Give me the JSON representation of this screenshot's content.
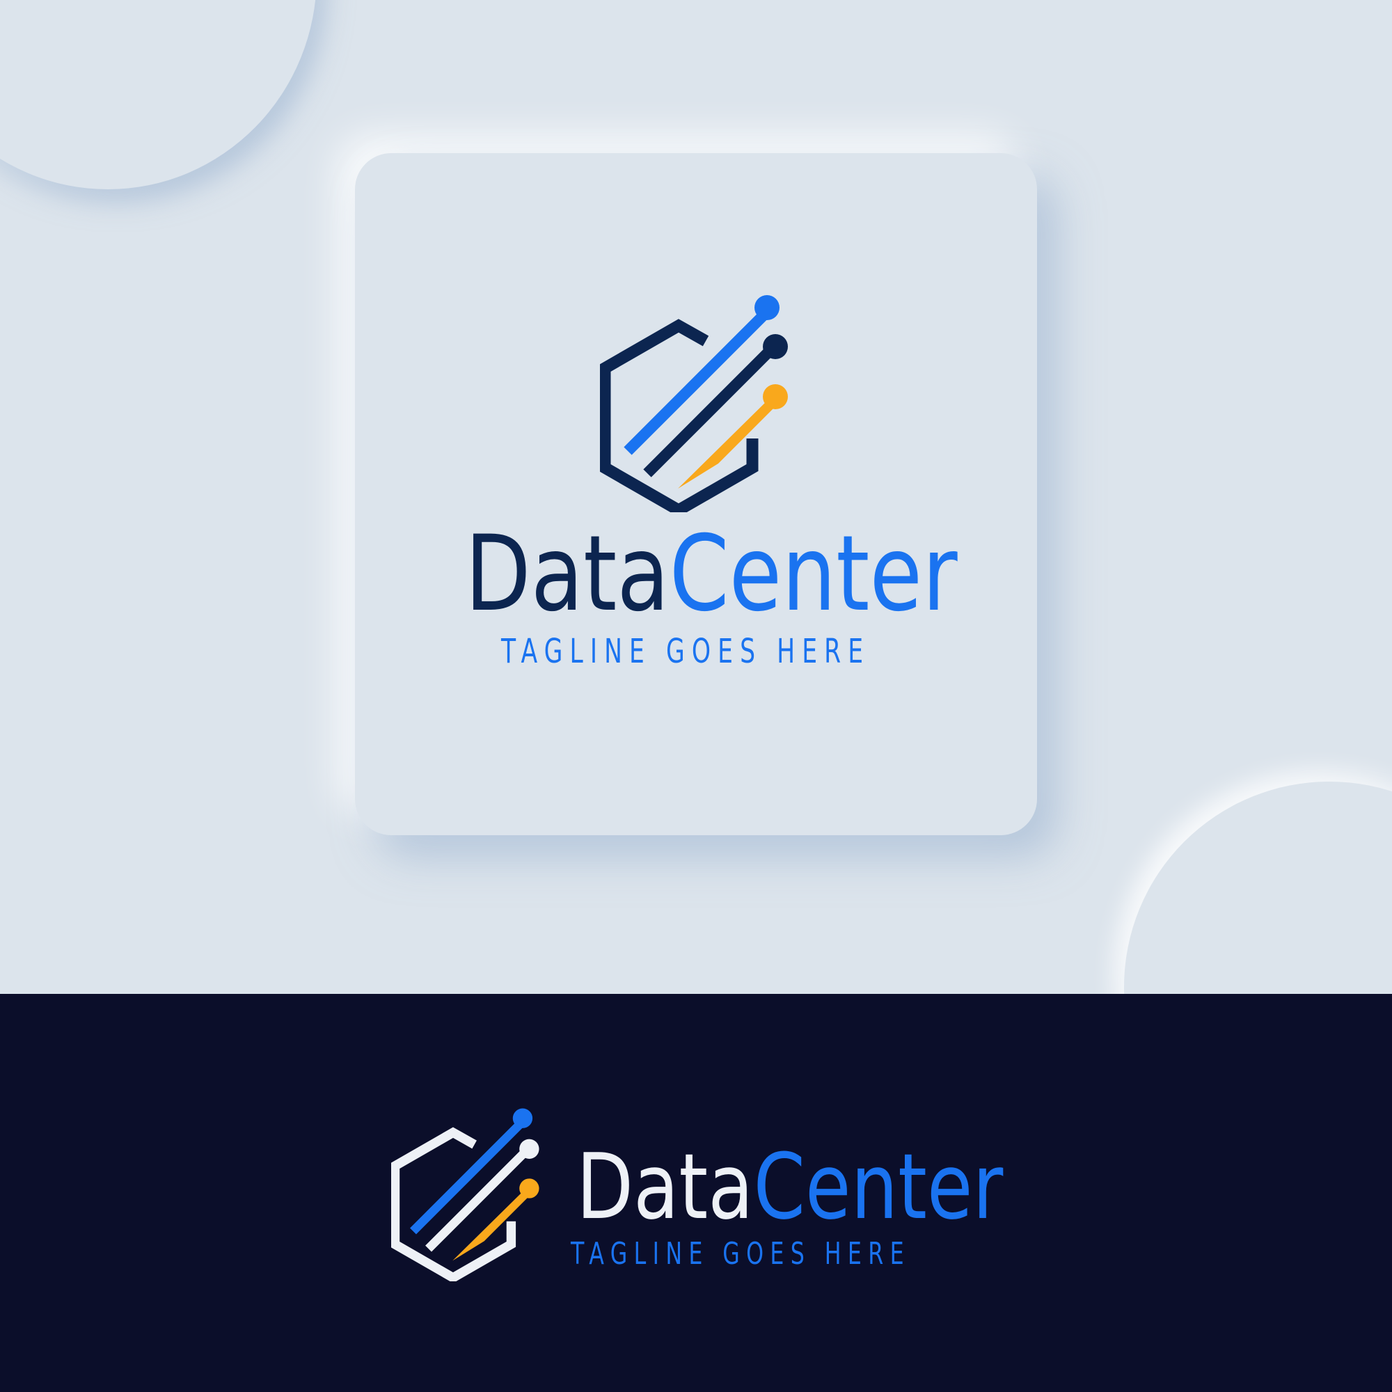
{
  "brand": {
    "name_part1": "Data",
    "name_part2": "Center",
    "tagline": "TAGLINE GOES HERE"
  },
  "colors": {
    "background_light": "#dce4ec",
    "background_dark": "#0b0e2a",
    "navy": "#0c2550",
    "blue": "#1a73f0",
    "orange": "#f9a81c",
    "white": "#eef1f6"
  },
  "icons": {
    "logo_mark": "hexagon-data-lines-icon"
  }
}
